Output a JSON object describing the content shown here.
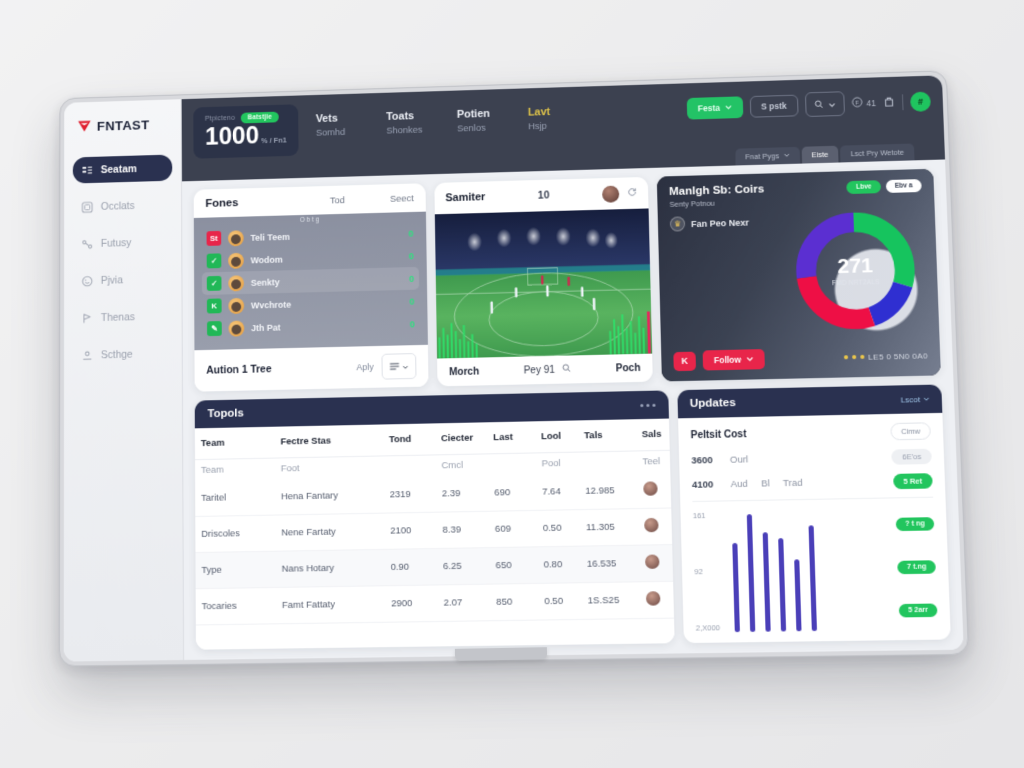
{
  "brand": {
    "name": "FNTAST",
    "logo_icon": "triangle-shield-icon",
    "logo_color": "#e02030"
  },
  "sidebar": {
    "items": [
      {
        "label": "Seatam",
        "icon": "list-icon",
        "active": true
      },
      {
        "label": "Occlats",
        "icon": "grid-icon",
        "active": false
      },
      {
        "label": "Futusy",
        "icon": "share-icon",
        "active": false
      },
      {
        "label": "Pjvia",
        "icon": "face-icon",
        "active": false
      },
      {
        "label": "Thenas",
        "icon": "flag-icon",
        "active": false
      },
      {
        "label": "Scthge",
        "icon": "settings-icon",
        "active": false
      }
    ]
  },
  "topbar": {
    "hero": {
      "label": "Ptpicteno",
      "badge": "Batstjie",
      "value": "1000",
      "suffix": "% / Fn1"
    },
    "stats": [
      {
        "title": "Vets",
        "sub": "Somhd",
        "accent": false
      },
      {
        "title": "Toats",
        "sub": "Shonkes",
        "accent": false
      },
      {
        "title": "Potien",
        "sub": "Senlos",
        "accent": false
      },
      {
        "title": "Lavt",
        "sub": "Hsjp",
        "accent": true
      }
    ],
    "actions": {
      "primary_label": "Festa",
      "outline_label": "S pstk",
      "search_icon": "search-icon",
      "chevron_icon": "chevron-down-icon",
      "coin_icon": "coin-icon",
      "coin_value": "41",
      "bag_icon": "bag-icon",
      "avatar_initial": "#"
    },
    "tabs": [
      {
        "label": "Fnat Pygs",
        "state": "ghost",
        "has_chevron": true
      },
      {
        "label": "Eiste",
        "state": "sel",
        "has_chevron": false
      },
      {
        "label": "Lsct Pry Wetote",
        "state": "ghost",
        "has_chevron": false
      }
    ]
  },
  "players_card": {
    "title": "Fones",
    "col2": "Tod",
    "col3": "Seect",
    "subhead": "O b t g",
    "rows": [
      {
        "chip": "St",
        "chip_color": "#e8254a",
        "name": "Teli Teem",
        "value": "0"
      },
      {
        "chip": "✓",
        "chip_color": "#21b857",
        "name": "Wodom",
        "value": "0"
      },
      {
        "chip": "✓",
        "chip_color": "#21b857",
        "name": "Senkty",
        "value": "0"
      },
      {
        "chip": "K",
        "chip_color": "#21b857",
        "name": "Wvchrote",
        "value": "0"
      },
      {
        "chip": "✎",
        "chip_color": "#21b857",
        "name": "Jth Pat",
        "value": "0"
      }
    ],
    "footer": {
      "title": "Aution 1 Tree",
      "action": "Aply",
      "menu_icon": "list-menu-icon"
    }
  },
  "match_card": {
    "title": "Samiter",
    "score": "10",
    "avatar_name": "match-avatar",
    "refresh_icon": "refresh-icon",
    "footer": {
      "left": "Morch",
      "center": "Pey 91",
      "search_icon": "search-icon",
      "right": "Poch"
    }
  },
  "standings_card": {
    "title": "Manlgh Sb: Coirs",
    "subtitle": "Senty Potnou",
    "meta_label": "Fan Peo Nexr",
    "trophy_icon": "trophy-icon",
    "chips": [
      {
        "label": "Lbve",
        "style": "live"
      },
      {
        "label": "Ebv a",
        "style": "white"
      }
    ],
    "donut": {
      "center_value": "271",
      "center_label": "FMD NRT2ALS"
    },
    "footer": {
      "square_label": "K",
      "pill_label": "Follow",
      "chevron_icon": "chevron-down-icon",
      "score_text": "LE5 0 5N0 0A0"
    },
    "chart_data": {
      "type": "pie",
      "title": "Manlgh Sb: Coirs",
      "labels": [
        "Green",
        "Blue",
        "Red",
        "Purple"
      ],
      "values": [
        30,
        15,
        28,
        27
      ],
      "colors": [
        "#16c45e",
        "#2f2fd1",
        "#ee0f45",
        "#5b2fd1"
      ],
      "center_value": "271",
      "center_label": "FMD NRT2ALS",
      "legend": "none"
    }
  },
  "table_card": {
    "title": "Topols",
    "kebab_icon": "kebab-icon",
    "columns": [
      "Team",
      "Feсtre Stas",
      "Tond",
      "Ciecter",
      "Last",
      "Lool",
      "Tals",
      "Sals"
    ],
    "subrow": [
      "Team",
      "Foot",
      "",
      "Cmcl",
      "",
      "Pool",
      "",
      "Teel",
      ""
    ],
    "rows": [
      {
        "cells": [
          "Taritel",
          "Hena Fantary",
          "2319",
          "2.39",
          "690",
          "7.64",
          "12.985"
        ],
        "avatar": "row-avatar"
      },
      {
        "cells": [
          "Driscoles",
          "Nene Fartaty",
          "2100",
          "8.39",
          "609",
          "0.50",
          "11.305"
        ],
        "avatar": "row-avatar"
      },
      {
        "cells": [
          "Type",
          "Nans Hotary",
          "0.90",
          "6.25",
          "650",
          "0.80",
          "16.535"
        ],
        "avatar": "row-avatar"
      },
      {
        "cells": [
          "Tocaries",
          "Famt Fattaty",
          "2900",
          "2.07",
          "850",
          "0.50",
          "1S.S25"
        ],
        "avatar": "row-avatar"
      }
    ]
  },
  "updates_card": {
    "title": "Updates",
    "head_action": "Lscot",
    "head_chevron": "chevron-down-icon",
    "row1": {
      "title": "Peltsit Cost",
      "pill": "Cimw"
    },
    "lines": [
      {
        "num": "3600",
        "word": "Ourl",
        "word2": "",
        "word3": "",
        "pill": "6E'os",
        "pill_style": "grey"
      },
      {
        "num": "4100",
        "word": "Aud",
        "word2": "Bl",
        "word3": "Trad",
        "pill": "5 Ret",
        "pill_style": "green"
      }
    ],
    "chart_data": {
      "type": "bar",
      "title": "Updates",
      "categories": [
        "1",
        "2",
        "3",
        "4",
        "5",
        "6"
      ],
      "values": [
        72,
        95,
        80,
        75,
        58,
        85
      ],
      "ylim": [
        0,
        100
      ],
      "ytick_labels": [
        "161",
        "92",
        "2,X000"
      ],
      "bar_color": "#4a3fb8",
      "grid": false,
      "legend": "none"
    },
    "axis_labels": [
      "161",
      "92",
      "2,X000"
    ],
    "side_pills": [
      "? t ng",
      "7 t.ng",
      "5 2arr"
    ]
  }
}
